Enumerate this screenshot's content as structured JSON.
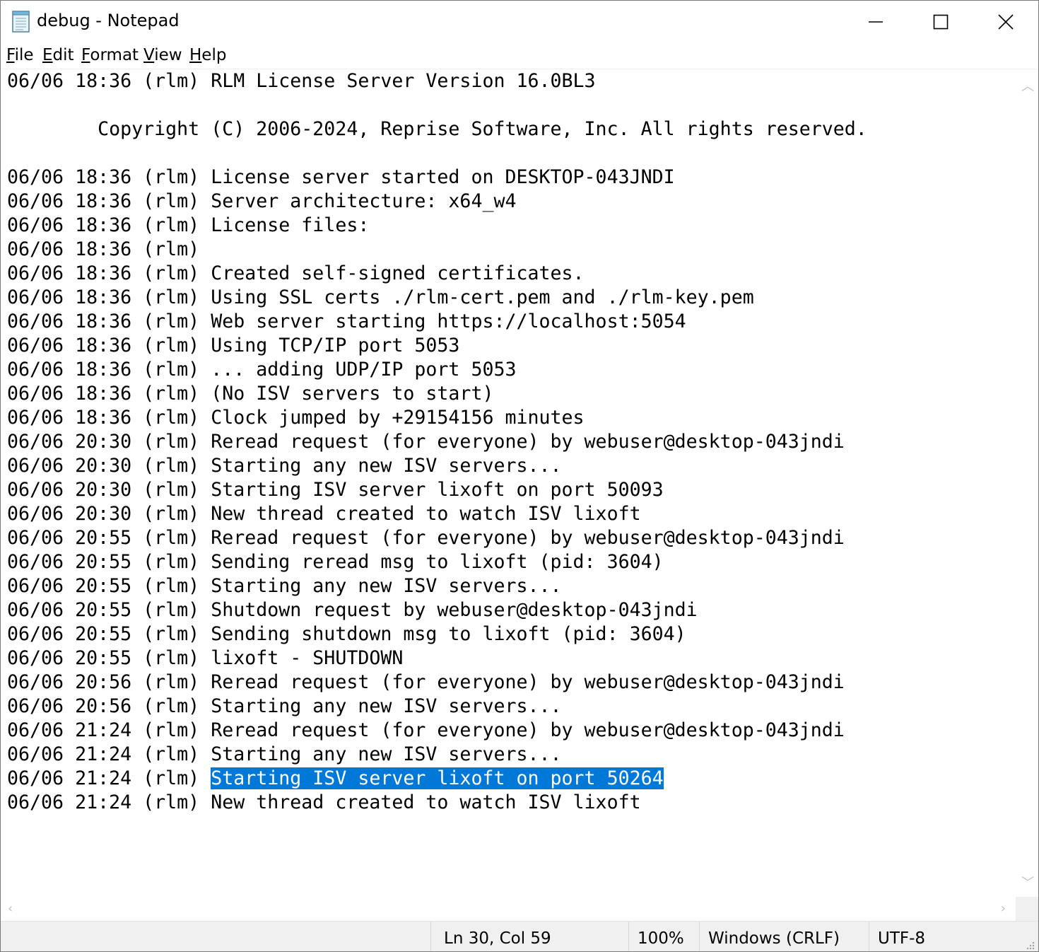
{
  "window": {
    "title": "debug - Notepad"
  },
  "menu": [
    {
      "accel": "F",
      "rest": "ile"
    },
    {
      "accel": "E",
      "rest": "dit"
    },
    {
      "accel": "F",
      "pre": "",
      "rest": "ormat"
    },
    {
      "accel": "V",
      "rest": "iew"
    },
    {
      "accel": "H",
      "rest": "elp"
    }
  ],
  "editor": {
    "lines": [
      "06/06 18:36 (rlm) RLM License Server Version 16.0BL3",
      "",
      "        Copyright (C) 2006-2024, Reprise Software, Inc. All rights reserved.",
      "",
      "06/06 18:36 (rlm) License server started on DESKTOP-043JNDI",
      "06/06 18:36 (rlm) Server architecture: x64_w4",
      "06/06 18:36 (rlm) License files:",
      "06/06 18:36 (rlm)",
      "06/06 18:36 (rlm) Created self-signed certificates.",
      "06/06 18:36 (rlm) Using SSL certs ./rlm-cert.pem and ./rlm-key.pem",
      "06/06 18:36 (rlm) Web server starting https://localhost:5054",
      "06/06 18:36 (rlm) Using TCP/IP port 5053",
      "06/06 18:36 (rlm) ... adding UDP/IP port 5053",
      "06/06 18:36 (rlm) (No ISV servers to start)",
      "06/06 18:36 (rlm) Clock jumped by +29154156 minutes",
      "06/06 20:30 (rlm) Reread request (for everyone) by webuser@desktop-043jndi",
      "06/06 20:30 (rlm) Starting any new ISV servers...",
      "06/06 20:30 (rlm) Starting ISV server lixoft on port 50093",
      "06/06 20:30 (rlm) New thread created to watch ISV lixoft",
      "06/06 20:55 (rlm) Reread request (for everyone) by webuser@desktop-043jndi",
      "06/06 20:55 (rlm) Sending reread msg to lixoft (pid: 3604)",
      "06/06 20:55 (rlm) Starting any new ISV servers...",
      "06/06 20:55 (rlm) Shutdown request by webuser@desktop-043jndi",
      "06/06 20:55 (rlm) Sending shutdown msg to lixoft (pid: 3604)",
      "06/06 20:55 (rlm) lixoft - SHUTDOWN",
      "06/06 20:56 (rlm) Reread request (for everyone) by webuser@desktop-043jndi",
      "06/06 20:56 (rlm) Starting any new ISV servers...",
      "06/06 21:24 (rlm) Reread request (for everyone) by webuser@desktop-043jndi",
      "06/06 21:24 (rlm) Starting any new ISV servers...",
      "06/06 21:24 (rlm) Starting ISV server lixoft on port 50264",
      "06/06 21:24 (rlm) New thread created to watch ISV lixoft"
    ],
    "selection": {
      "line_index": 29,
      "selected_text": "Starting ISV server lixoft on port 50264",
      "prefix": "06/06 21:24 (rlm) "
    },
    "selection_color": "#0078d7"
  },
  "status": {
    "position": "Ln 30, Col 59",
    "zoom": "100%",
    "line_ending": "Windows (CRLF)",
    "encoding": "UTF-8"
  }
}
